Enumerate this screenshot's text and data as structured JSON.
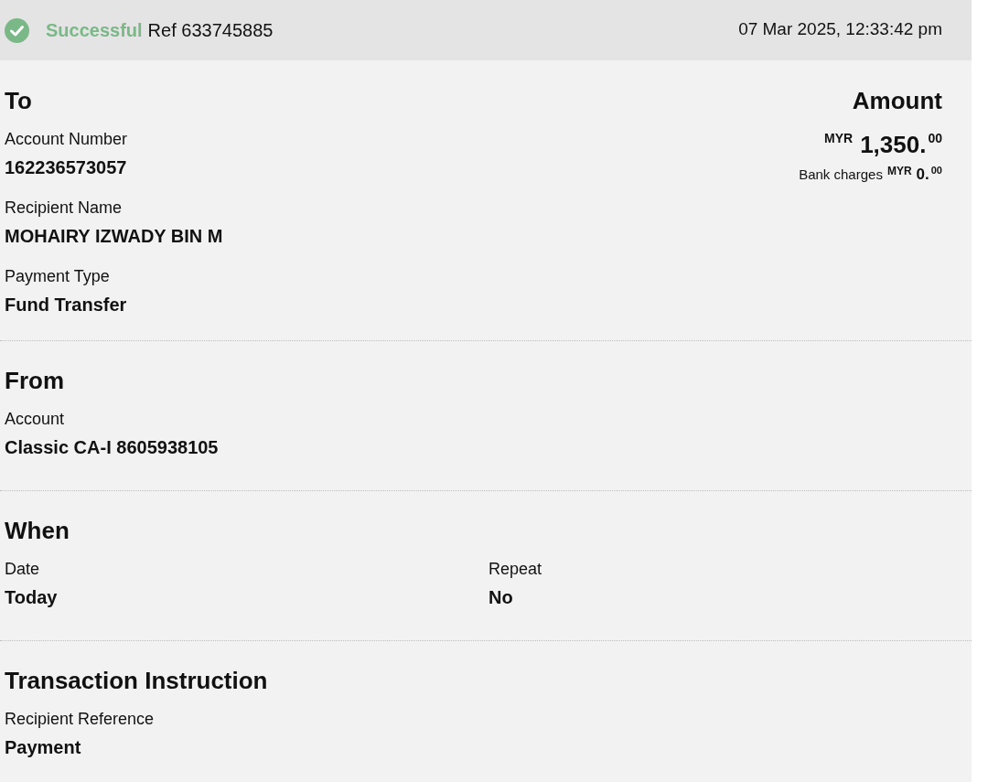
{
  "header": {
    "status": "Successful",
    "reference": "Ref 633745885",
    "timestamp": "07 Mar 2025, 12:33:42 pm"
  },
  "to": {
    "title": "To",
    "fields": [
      {
        "label": "Account Number",
        "value": "162236573057"
      },
      {
        "label": "Recipient Name",
        "value": "MOHAIRY IZWADY BIN M"
      },
      {
        "label": "Payment Type",
        "value": "Fund Transfer"
      }
    ]
  },
  "amount": {
    "title": "Amount",
    "currency": "MYR",
    "value": "1,350.$^{00}$",
    "charges": {
      "label": "Bank charges",
      "currency": "MYR",
      "value": "0.$^{00}$"
    }
  },
  "sections": [
    {
      "title": "From",
      "kind": "stacked",
      "fields": [
        {
          "label": "Account",
          "value": "Classic CA-I 8605938105"
        }
      ]
    },
    {
      "title": "When",
      "kind": "columns",
      "fields": [
        {
          "label": "Date",
          "value": "Today"
        },
        {
          "label": "Repeat",
          "value": "No"
        }
      ]
    },
    {
      "title": "Transaction Instruction",
      "kind": "stacked",
      "fields": [
        {
          "label": "Recipient Reference",
          "value": "Payment"
        }
      ]
    }
  ]
}
